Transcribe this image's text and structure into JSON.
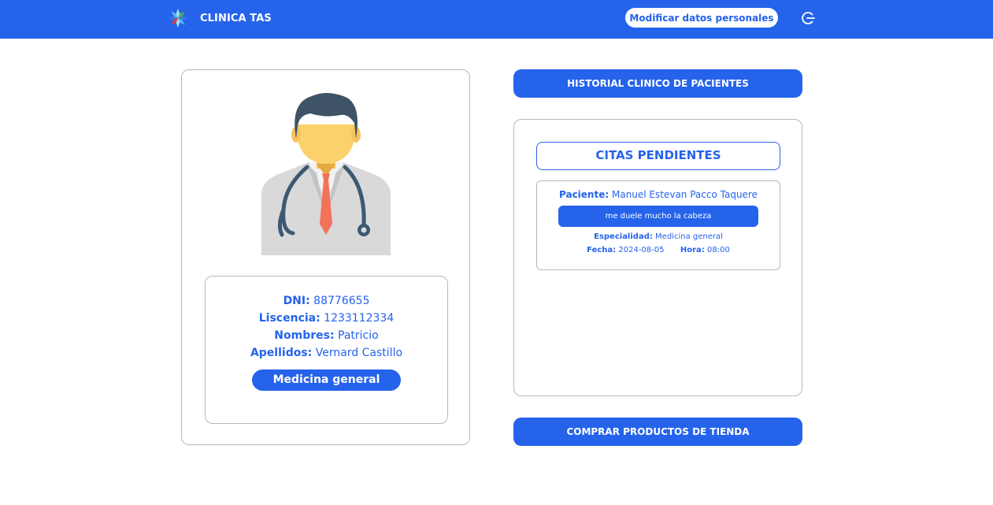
{
  "header": {
    "brand_name": "CLINICA TAS",
    "modify_label": "Modificar datos personales",
    "logout_icon": "logout-icon",
    "color": "#2563eb"
  },
  "doctor": {
    "image_icon": "doctor-avatar",
    "dni_label": "DNI:",
    "dni_value": "88776655",
    "license_label": "Liscencia:",
    "license_value": "1233112334",
    "names_label": "Nombres:",
    "names_value": "Patricio",
    "surnames_label": "Apellidos:",
    "surnames_value": "Vernard Castillo",
    "specialty": "Medicina general"
  },
  "actions": {
    "historial_label": "HISTORIAL CLINICO DE PACIENTES",
    "comprar_label": "COMPRAR PRODUCTOS DE TIENDA"
  },
  "citas": {
    "title": "CITAS PENDIENTES",
    "items": [
      {
        "patient_label": "Paciente:",
        "patient_value": "Manuel Estevan Pacco Taquere",
        "reason": "me duele mucho la cabeza",
        "specialty_label": "Especialidad:",
        "specialty_value": "Medicina general",
        "date_label": "Fecha:",
        "date_value": "2024-08-05",
        "time_label": "Hora:",
        "time_value": "08:00"
      }
    ]
  }
}
